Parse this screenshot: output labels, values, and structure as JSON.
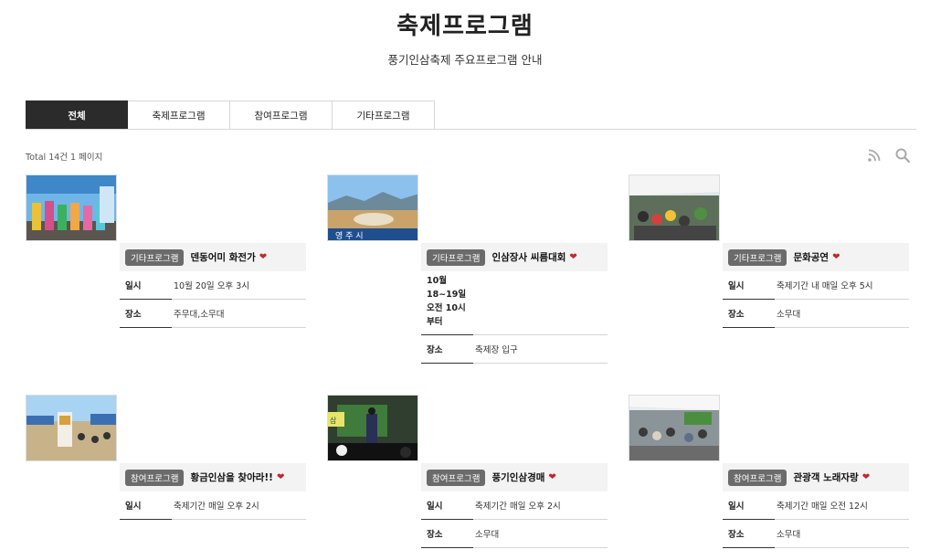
{
  "page": {
    "title": "축제프로그램",
    "subtitle": "풍기인삼축제 주요프로그램 안내"
  },
  "tabs": [
    {
      "label": "전체",
      "active": true
    },
    {
      "label": "축제프로그램",
      "active": false
    },
    {
      "label": "참여프로그램",
      "active": false
    },
    {
      "label": "기타프로그램",
      "active": false
    }
  ],
  "listing": {
    "total_text": "Total 14건 1 페이지",
    "icons": [
      "rss-icon",
      "search-icon"
    ]
  },
  "cards": [
    {
      "category": "기타프로그램",
      "name": "덴동어미 화전가",
      "date_label": "일시",
      "date_value": "10월 20일 오후 3시",
      "place_label": "장소",
      "place_value": "주무대,소무대"
    },
    {
      "category": "기타프로그램",
      "name": "인삼장사 씨름대회",
      "date_label": "10월 18~19일 오전 10시 부터",
      "date_value": "",
      "place_label": "장소",
      "place_value": "축제장 입구"
    },
    {
      "category": "기타프로그램",
      "name": "문화공연",
      "date_label": "일시",
      "date_value": "축제기간 내 매일 오후 5시",
      "place_label": "장소",
      "place_value": "소무대"
    },
    {
      "category": "참여프로그램",
      "name": "황금인삼을 찾아라!!",
      "date_label": "일시",
      "date_value": "축제기간 매일 오후 2시",
      "place_label": "",
      "place_value": ""
    },
    {
      "category": "참여프로그램",
      "name": "풍기인삼경매",
      "date_label": "일시",
      "date_value": "축제기간 매일 오후 2시",
      "place_label": "장소",
      "place_value": "소무대"
    },
    {
      "category": "참여프로그램",
      "name": "관광객 노래자랑",
      "date_label": "일시",
      "date_value": "축제기간 매일 오전 12시",
      "place_label": "장소",
      "place_value": "소무대"
    }
  ],
  "colors": {
    "active_tab": "#2b2b2b",
    "badge": "#6b6b6b",
    "heart": "#c0282b"
  }
}
